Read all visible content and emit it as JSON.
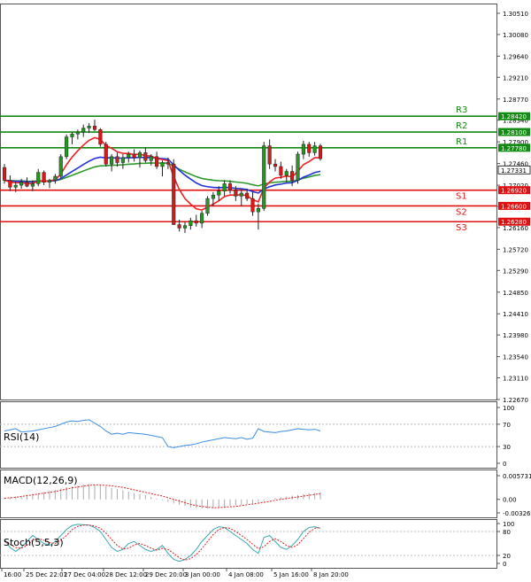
{
  "chart_data": {
    "type": "candlestick",
    "price_axis": {
      "ticks": [
        "1.30510",
        "1.30080",
        "1.29640",
        "1.29210",
        "1.28770",
        "1.28340",
        "1.27900",
        "1.27460",
        "1.27020",
        "1.26590",
        "1.26160",
        "1.25720",
        "1.25290",
        "1.24850",
        "1.24410",
        "1.23980",
        "1.23540",
        "1.23110",
        "1.22670"
      ],
      "current_price": "1.27331"
    },
    "x_ticks": [
      "16:00",
      "25 Dec 22:01",
      "27 Dec 04:00",
      "28 Dec 12:00",
      "29 Dec 20:00",
      "3 Jan 00:00",
      "4 Jan 08:00",
      "5 Jan 16:00",
      "8 Jan 20:00"
    ],
    "levels": [
      {
        "name": "R3",
        "value": "1.28420",
        "color": "#138a13"
      },
      {
        "name": "R2",
        "value": "1.28100",
        "color": "#138a13"
      },
      {
        "name": "R1",
        "value": "1.27780",
        "color": "#138a13"
      },
      {
        "name": "S1",
        "value": "1.26920",
        "color": "#e01010"
      },
      {
        "name": "S2",
        "value": "1.26600",
        "color": "#e01010"
      },
      {
        "name": "S3",
        "value": "1.26280",
        "color": "#e01010"
      }
    ],
    "candles": [
      [
        1.2738,
        1.2745,
        1.2705,
        1.2712
      ],
      [
        1.2712,
        1.2722,
        1.269,
        1.2698
      ],
      [
        1.2698,
        1.271,
        1.2688,
        1.2702
      ],
      [
        1.2702,
        1.2715,
        1.2695,
        1.2708
      ],
      [
        1.2708,
        1.2718,
        1.2698,
        1.27
      ],
      [
        1.27,
        1.2712,
        1.269,
        1.2705
      ],
      [
        1.2705,
        1.2735,
        1.27,
        1.2728
      ],
      [
        1.2728,
        1.2732,
        1.2702,
        1.2708
      ],
      [
        1.2708,
        1.2715,
        1.2696,
        1.2712
      ],
      [
        1.2712,
        1.2725,
        1.2705,
        1.272
      ],
      [
        1.272,
        1.2765,
        1.2715,
        1.276
      ],
      [
        1.276,
        1.2805,
        1.2755,
        1.28
      ],
      [
        1.28,
        1.281,
        1.2785,
        1.2806
      ],
      [
        1.2806,
        1.2815,
        1.2795,
        1.281
      ],
      [
        1.281,
        1.2825,
        1.28,
        1.2818
      ],
      [
        1.2818,
        1.2828,
        1.2808,
        1.2822
      ],
      [
        1.2822,
        1.2835,
        1.2812,
        1.2815
      ],
      [
        1.2815,
        1.2818,
        1.278,
        1.2785
      ],
      [
        1.2785,
        1.279,
        1.274,
        1.2745
      ],
      [
        1.2745,
        1.2765,
        1.273,
        1.276
      ],
      [
        1.276,
        1.2768,
        1.274,
        1.2748
      ],
      [
        1.2748,
        1.2765,
        1.2735,
        1.2758
      ],
      [
        1.2758,
        1.277,
        1.2748,
        1.2765
      ],
      [
        1.2765,
        1.2775,
        1.275,
        1.2758
      ],
      [
        1.2758,
        1.2772,
        1.2738,
        1.2768
      ],
      [
        1.2768,
        1.2778,
        1.2748,
        1.2752
      ],
      [
        1.2752,
        1.2765,
        1.2742,
        1.276
      ],
      [
        1.276,
        1.277,
        1.2735,
        1.274
      ],
      [
        1.274,
        1.2752,
        1.272,
        1.2748
      ],
      [
        1.2748,
        1.2758,
        1.2735,
        1.2745
      ],
      [
        1.2745,
        1.2755,
        1.2665,
        1.2622
      ],
      [
        1.2622,
        1.2632,
        1.2608,
        1.2615
      ],
      [
        1.2615,
        1.2628,
        1.2605,
        1.262
      ],
      [
        1.262,
        1.2636,
        1.2612,
        1.263
      ],
      [
        1.263,
        1.2642,
        1.2618,
        1.2625
      ],
      [
        1.2625,
        1.265,
        1.2615,
        1.2645
      ],
      [
        1.2645,
        1.268,
        1.264,
        1.2675
      ],
      [
        1.2675,
        1.2688,
        1.266,
        1.2682
      ],
      [
        1.2682,
        1.27,
        1.267,
        1.269
      ],
      [
        1.269,
        1.2712,
        1.268,
        1.2705
      ],
      [
        1.2705,
        1.2712,
        1.2685,
        1.2692
      ],
      [
        1.2692,
        1.27,
        1.267,
        1.268
      ],
      [
        1.268,
        1.2692,
        1.266,
        1.2686
      ],
      [
        1.2686,
        1.2695,
        1.267,
        1.2675
      ],
      [
        1.2675,
        1.2688,
        1.264,
        1.2648
      ],
      [
        1.2648,
        1.2665,
        1.2612,
        1.2655
      ],
      [
        1.2655,
        1.279,
        1.265,
        1.2782
      ],
      [
        1.2782,
        1.2795,
        1.2735,
        1.2745
      ],
      [
        1.2745,
        1.2755,
        1.273,
        1.274
      ],
      [
        1.274,
        1.275,
        1.2715,
        1.2722
      ],
      [
        1.2722,
        1.2735,
        1.2708,
        1.273
      ],
      [
        1.273,
        1.2742,
        1.27,
        1.2712
      ],
      [
        1.2712,
        1.277,
        1.2705,
        1.2765
      ],
      [
        1.2765,
        1.2792,
        1.2755,
        1.2785
      ],
      [
        1.2785,
        1.279,
        1.276,
        1.2768
      ],
      [
        1.2768,
        1.279,
        1.2762,
        1.2782
      ],
      [
        1.2782,
        1.2786,
        1.2752,
        1.2756
      ]
    ],
    "rsi": {
      "label": "RSI(14)",
      "ticks": [
        "100",
        "70",
        "30",
        "0"
      ],
      "values": [
        58,
        60,
        62,
        56,
        57,
        58,
        60,
        62,
        64,
        66,
        70,
        74,
        76,
        75,
        77,
        78,
        72,
        66,
        58,
        52,
        54,
        52,
        55,
        54,
        53,
        52,
        50,
        48,
        46,
        30,
        28,
        30,
        32,
        33,
        35,
        38,
        40,
        42,
        44,
        46,
        45,
        44,
        46,
        43,
        45,
        62,
        57,
        56,
        55,
        57,
        58,
        60,
        62,
        61,
        60,
        61,
        58
      ]
    },
    "macd": {
      "label": "MACD(12,26,9)",
      "ticks": [
        "0.005731",
        "0.00",
        "-0.003269"
      ],
      "histogram": [
        0.0004,
        0.0005,
        0.0007,
        0.0009,
        0.0011,
        0.0013,
        0.0015,
        0.0018,
        0.002,
        0.0023,
        0.0026,
        0.0029,
        0.0031,
        0.0034,
        0.0036,
        0.0037,
        0.0036,
        0.0034,
        0.0031,
        0.0028,
        0.0025,
        0.0022,
        0.0019,
        0.0016,
        0.0013,
        0.001,
        0.0006,
        0.0002,
        -0.0002,
        -0.0006,
        -0.001,
        -0.0013,
        -0.0016,
        -0.0019,
        -0.0021,
        -0.0022,
        -0.0022,
        -0.0021,
        -0.002,
        -0.0018,
        -0.0016,
        -0.0015,
        -0.0013,
        -0.0011,
        -0.0009,
        -0.0006,
        -0.0003,
        0.0,
        0.0003,
        0.0005,
        0.0007,
        0.0009,
        0.0011,
        0.0013,
        0.0015,
        0.0016,
        0.0017
      ],
      "signal": [
        0.0003,
        0.0004,
        0.0005,
        0.0007,
        0.0009,
        0.0011,
        0.0013,
        0.0015,
        0.0017,
        0.0019,
        0.0022,
        0.0025,
        0.0028,
        0.003,
        0.0032,
        0.0034,
        0.0035,
        0.0035,
        0.0034,
        0.0033,
        0.0031,
        0.0029,
        0.0026,
        0.0023,
        0.002,
        0.0017,
        0.0014,
        0.0011,
        0.0008,
        0.0004,
        0.0,
        -0.0004,
        -0.0008,
        -0.0012,
        -0.0015,
        -0.0017,
        -0.0019,
        -0.002,
        -0.002,
        -0.0019,
        -0.0018,
        -0.0017,
        -0.0015,
        -0.0013,
        -0.0011,
        -0.0009,
        -0.0007,
        -0.0005,
        -0.0002,
        0.0,
        0.0002,
        0.0004,
        0.0006,
        0.0008,
        0.001,
        0.0012,
        0.0014
      ]
    },
    "stoch": {
      "label": "Stoch(5,5,3)",
      "ticks": [
        "100",
        "80",
        "20",
        "0"
      ],
      "main": [
        60,
        40,
        30,
        40,
        55,
        70,
        60,
        50,
        45,
        55,
        70,
        85,
        95,
        98,
        97,
        96,
        90,
        80,
        60,
        40,
        30,
        35,
        50,
        55,
        45,
        35,
        30,
        35,
        45,
        25,
        10,
        5,
        10,
        20,
        35,
        55,
        70,
        85,
        92,
        90,
        80,
        70,
        60,
        50,
        35,
        25,
        65,
        70,
        55,
        40,
        35,
        45,
        60,
        80,
        90,
        92,
        88
      ],
      "signal": [
        55,
        48,
        40,
        38,
        45,
        58,
        62,
        58,
        52,
        50,
        58,
        70,
        85,
        93,
        96,
        96,
        94,
        88,
        76,
        60,
        45,
        36,
        38,
        46,
        50,
        45,
        38,
        33,
        38,
        35,
        25,
        14,
        8,
        12,
        22,
        37,
        55,
        72,
        85,
        90,
        88,
        80,
        70,
        60,
        48,
        37,
        42,
        55,
        62,
        55,
        45,
        40,
        47,
        62,
        78,
        88,
        90
      ]
    }
  }
}
